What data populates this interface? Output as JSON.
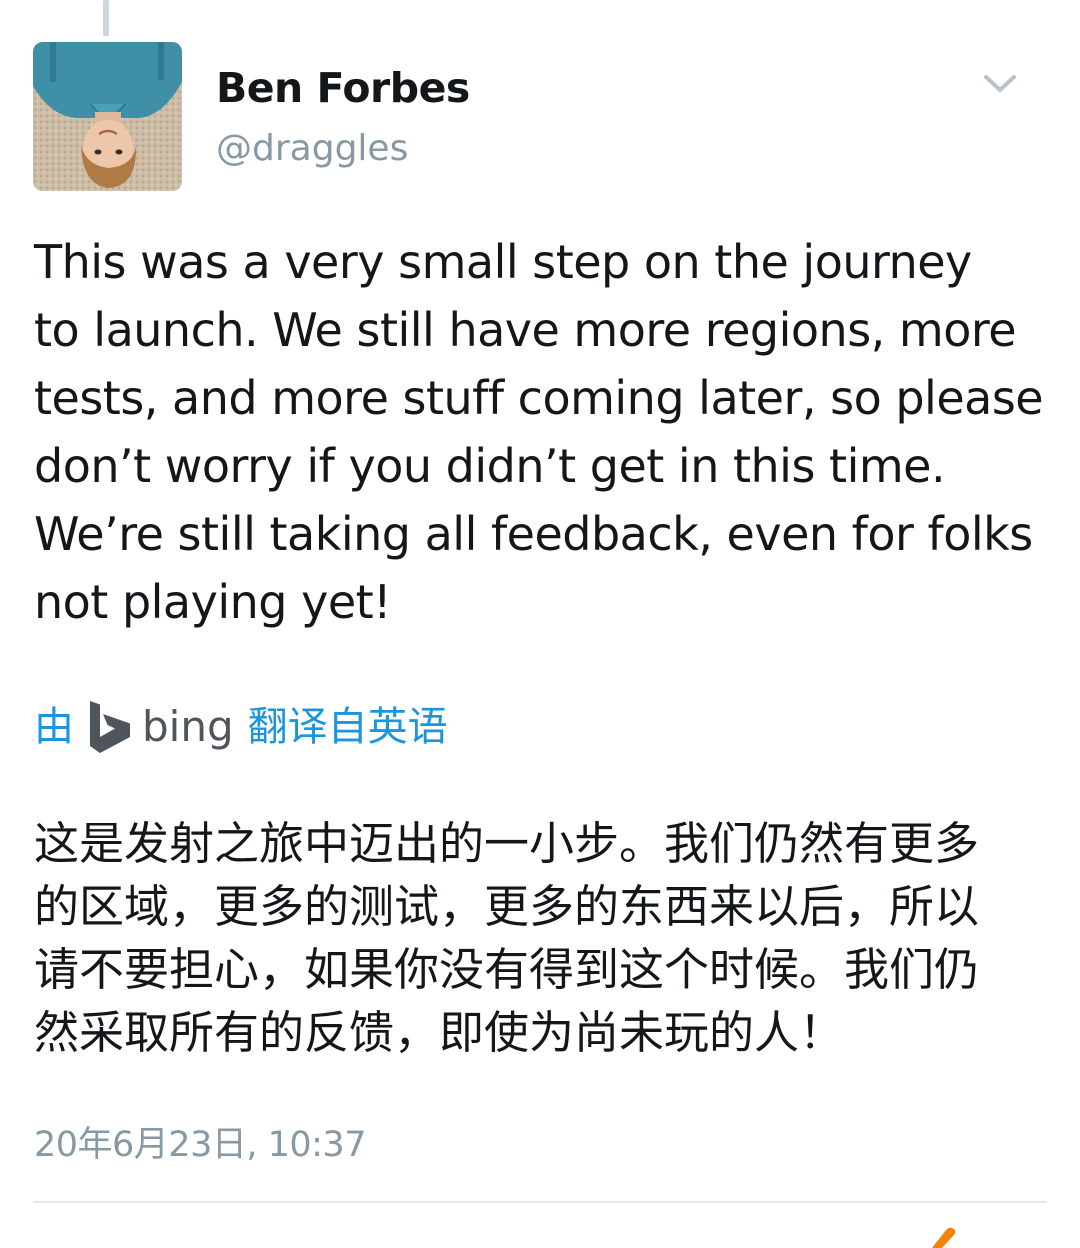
{
  "author": {
    "name": "Ben Forbes",
    "handle": "@draggles"
  },
  "tweet": {
    "lines": [
      "This was a very small step on the journey",
      "to launch. We still have more regions, more",
      "tests, and more stuff coming later, so please",
      "don’t worry if you didn’t get in this time.",
      "We’re still taking all feedback, even for folks",
      "not playing yet!"
    ]
  },
  "translation": {
    "prefix": "由",
    "provider": "bing",
    "suffix": "翻译自英语",
    "lines": [
      "这是发射之旅中迈出的一小步。我们仍然有更多",
      "的区域，更多的测试，更多的东西来以后，所以",
      "请不要担心，如果你没有得到这个时候。我们仍",
      "然采取所有的反馈，即使为尚未玩的人！"
    ]
  },
  "timestamp": "20年6月23日, 10:37",
  "colors": {
    "link": "#1b95e0",
    "text": "#14171a",
    "secondary": "#8899a6",
    "divider": "#e1e8ed",
    "accent_orange": "#f5820d"
  },
  "icons": {
    "menu": "chevron-down-icon",
    "bing": "bing-logo-icon"
  }
}
